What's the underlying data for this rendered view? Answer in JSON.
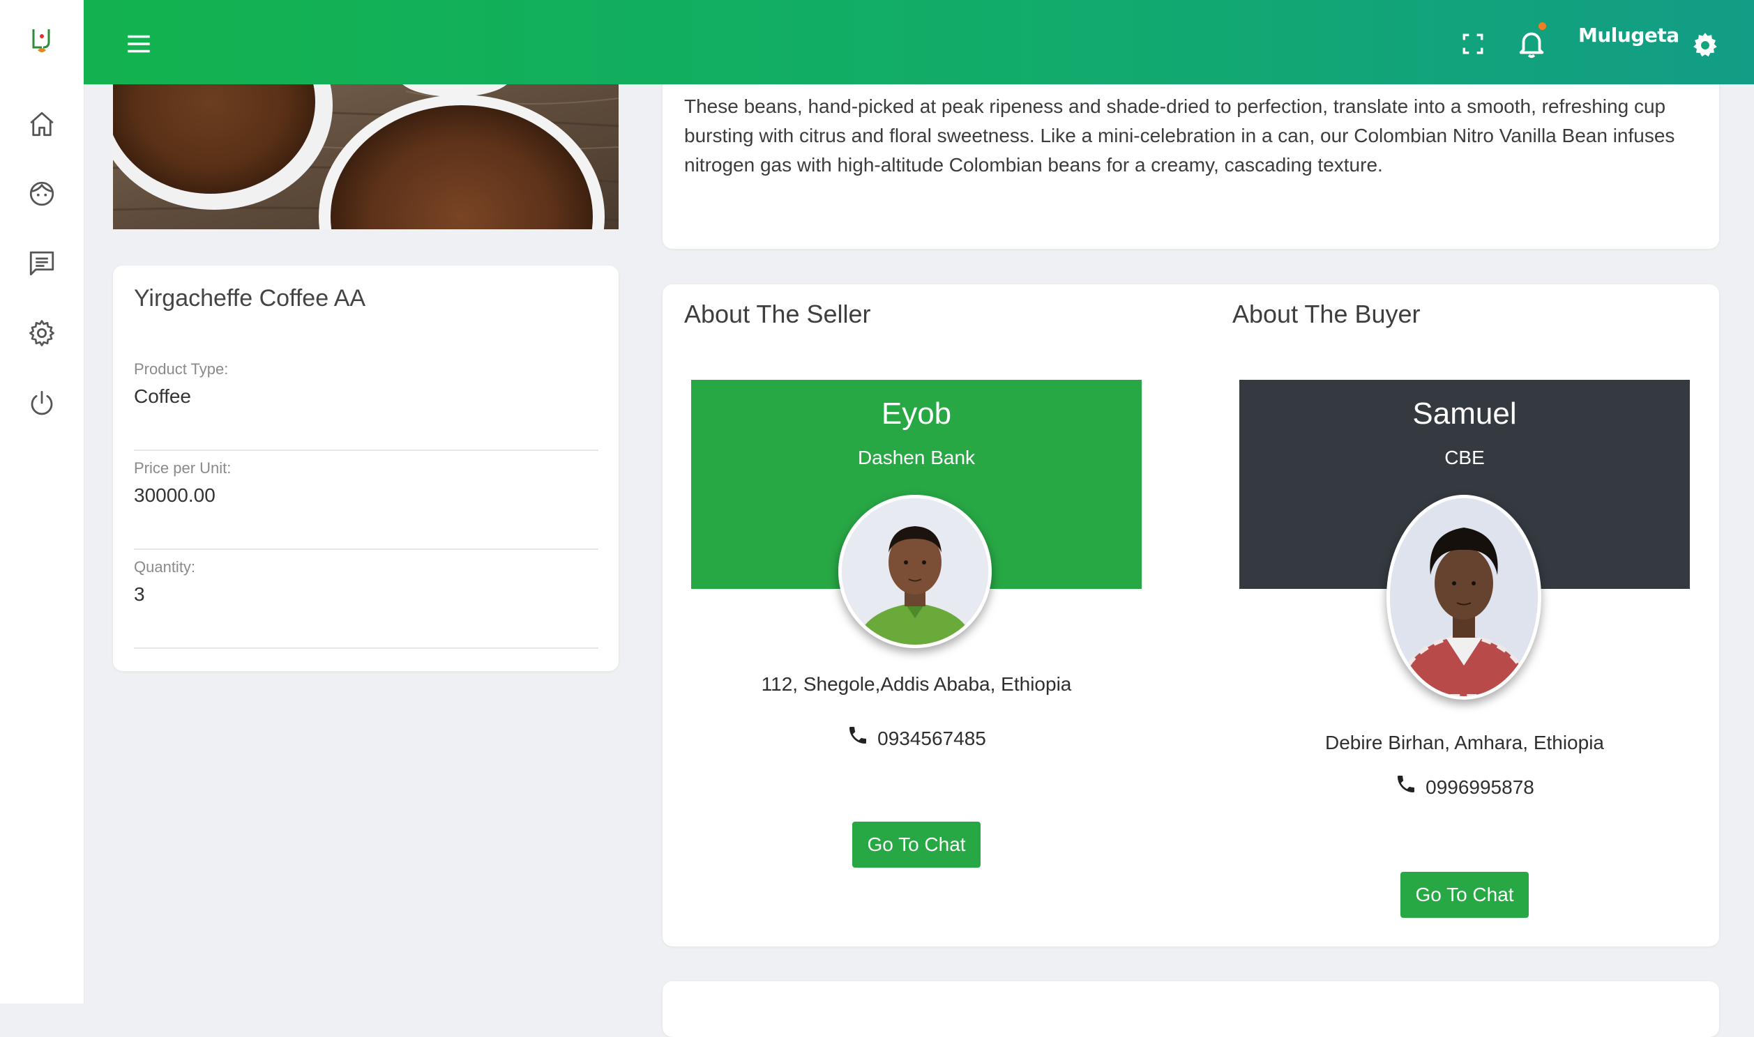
{
  "header": {
    "username": "Mulugeta",
    "accent_start": "#13b24e",
    "accent_end": "#129d86",
    "notification_dot_color": "#f57c1f"
  },
  "sidebar": {
    "items": [
      {
        "icon": "home-icon"
      },
      {
        "icon": "face-icon"
      },
      {
        "icon": "chat-icon"
      },
      {
        "icon": "settings-icon"
      },
      {
        "icon": "power-icon"
      }
    ]
  },
  "description": {
    "text": "These beans, hand-picked at peak ripeness and shade-dried to perfection, translate into a smooth, refreshing cup bursting with citrus and floral sweetness. Like a mini-celebration in a can, our Colombian Nitro Vanilla Bean infuses nitrogen gas with high-altitude Colombian beans for a creamy, cascading texture."
  },
  "product": {
    "title": "Yirgacheffe Coffee AA",
    "fields": [
      {
        "label": "Product Type:",
        "value": "Coffee"
      },
      {
        "label": "Price per Unit:",
        "value": "30000.00"
      },
      {
        "label": "Quantity:",
        "value": "3"
      }
    ]
  },
  "seller": {
    "section_title": "About The Seller",
    "name": "Eyob",
    "organization": "Dashen Bank",
    "address": "112, Shegole,Addis Ababa, Ethiopia",
    "phone": "0934567485",
    "chat_label": "Go To Chat",
    "banner_color": "#28a745"
  },
  "buyer": {
    "section_title": "About The Buyer",
    "name": "Samuel",
    "organization": "CBE",
    "address": "Debire Birhan, Amhara, Ethiopia",
    "phone": "0996995878",
    "chat_label": "Go To Chat",
    "banner_color": "#343a40"
  }
}
